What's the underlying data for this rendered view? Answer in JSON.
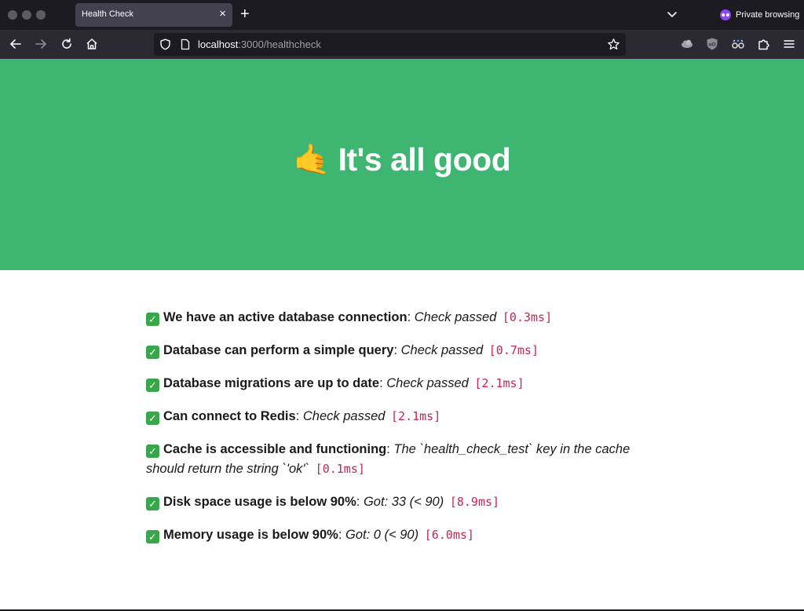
{
  "browser": {
    "tab": {
      "title": "Health Check",
      "close_glyph": "×"
    },
    "new_tab_glyph": "+",
    "private_label": "Private browsing",
    "url": {
      "host": "localhost",
      "rest": ":3000/healthcheck"
    },
    "icons": {
      "back": "back-arrow-icon",
      "forward": "forward-arrow-icon",
      "reload": "reload-icon",
      "home": "home-icon",
      "shield": "tracking-protection-shield-icon",
      "page": "page-icon",
      "star": "bookmark-star-icon",
      "extensions": [
        "cloud-extension-icon",
        "ublock-origin-icon",
        "glasses-extension-icon",
        "puzzle-extensions-icon",
        "hamburger-menu-icon"
      ]
    },
    "colors": {
      "tabbar": "#1c1b22",
      "navbar": "#2b2a33",
      "tab_active": "#42414d",
      "private_accent": "#8f44fb"
    }
  },
  "page": {
    "hero": {
      "emoji": "🤙",
      "title": "It's all good",
      "background": "#3eb571"
    },
    "checks": [
      {
        "name": "We have an active database connection",
        "message": "Check passed",
        "time": "[0.3ms]"
      },
      {
        "name": "Database can perform a simple query",
        "message": "Check passed",
        "time": "[0.7ms]"
      },
      {
        "name": "Database migrations are up to date",
        "message": "Check passed",
        "time": "[2.1ms]"
      },
      {
        "name": "Can connect to Redis",
        "message": "Check passed",
        "time": "[2.1ms]"
      },
      {
        "name": "Cache is accessible and functioning",
        "message": "The `health_check_test` key in the cache should return the string `'ok'`",
        "time": "[0.1ms]"
      },
      {
        "name": "Disk space usage is below 90%",
        "message": "Got: 33 (< 90)",
        "time": "[8.9ms]"
      },
      {
        "name": "Memory usage is below 90%",
        "message": "Got: 0 (< 90)",
        "time": "[6.0ms]"
      }
    ],
    "check_icon": "✓",
    "colors": {
      "check_icon": "#3aa64b",
      "timing": "#c7254e"
    }
  }
}
